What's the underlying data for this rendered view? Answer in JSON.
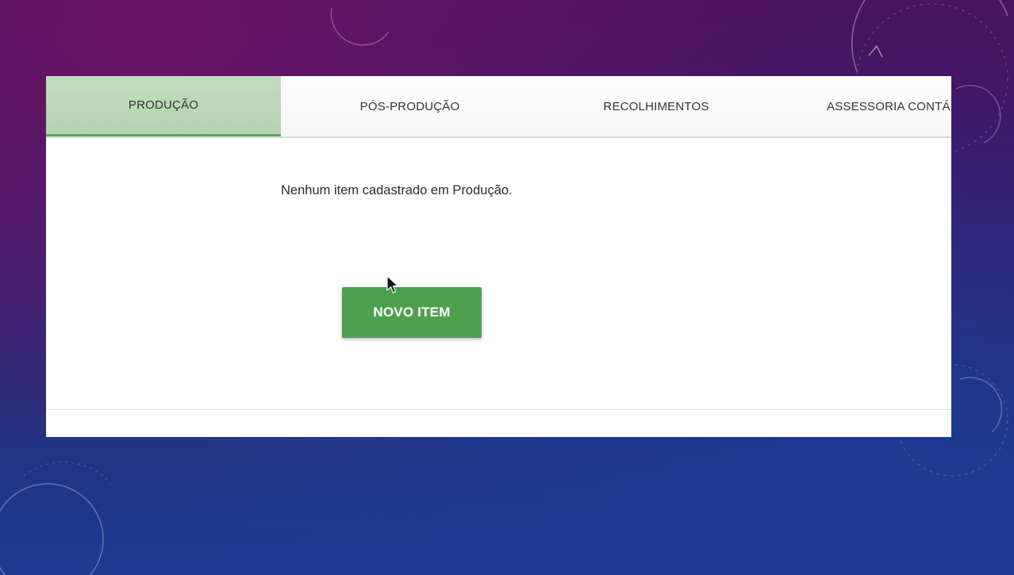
{
  "tabs": [
    {
      "label": "PRODUÇÃO",
      "active": true
    },
    {
      "label": "PÓS-PRODUÇÃO",
      "active": false
    },
    {
      "label": "RECOLHIMENTOS",
      "active": false
    },
    {
      "label": "ASSESSORIA CONTÁ",
      "active": false
    }
  ],
  "content": {
    "empty_message": "Nenhum item cadastrado em Produção.",
    "new_item_label": "NOVO ITEM"
  },
  "colors": {
    "accent_green": "#4ea04f",
    "active_tab_bg": "#b4d3b0",
    "slide_background_top": "#4a1460",
    "slide_background_bottom": "#1b3c92"
  },
  "icons": {
    "pointer": "mouse-pointer-icon"
  }
}
